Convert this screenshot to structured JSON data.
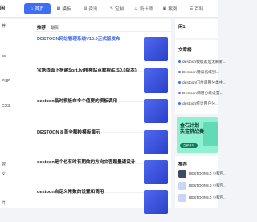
{
  "header": {
    "logo": "闲",
    "nav": [
      {
        "label": "首页",
        "icon": "home-icon",
        "glyph": "⌂",
        "active": true
      },
      {
        "label": "模板",
        "icon": "template-icon",
        "glyph": "▦",
        "active": false
      },
      {
        "label": "资讯",
        "icon": "news-icon",
        "glyph": "▤",
        "active": false
      },
      {
        "label": "定制",
        "icon": "custom-icon",
        "glyph": "✎",
        "active": false
      },
      {
        "label": "设计师",
        "icon": "designer-icon",
        "glyph": "☺",
        "active": false
      },
      {
        "label": "案例",
        "icon": "case-icon",
        "glyph": "▣",
        "active": false
      },
      {
        "label": "百科",
        "icon": "wiki-icon",
        "glyph": "☰",
        "active": false
      }
    ]
  },
  "left": {
    "items": [
      "荐",
      "",
      "ss",
      "",
      "",
      "PHP",
      "",
      "",
      "CSS",
      "",
      "",
      "",
      "",
      "",
      "",
      "容",
      "义",
      "",
      "",
      "",
      "件"
    ]
  },
  "main": {
    "tabs": [
      "推荐",
      "最新"
    ],
    "items": [
      {
        "title": "DESTOON网站管理系统V10.0正式版发布",
        "blue": true,
        "desc": "",
        "meta": "",
        "thumb": ""
      },
      {
        "title": "宝塔线面下搭建Sort.fyi排神站点教程(EIS0.0版本)",
        "blue": false,
        "desc": "",
        "meta": "",
        "thumb": ""
      },
      {
        "title": "destoon临时模板命令个值要的模板调用",
        "blue": false,
        "desc": "",
        "meta": "",
        "thumb": ""
      },
      {
        "title": "DESTOON 8 首全额检模板演示",
        "blue": false,
        "desc": "",
        "meta": "",
        "thumb": ""
      },
      {
        "title": "destoon是个也有时有期效的方向文客题量通设计",
        "blue": false,
        "desc": "",
        "meta": "",
        "thumb": ""
      },
      {
        "title": "destoon自定义常数的设置和调用",
        "blue": false,
        "desc": "",
        "meta": "",
        "thumb": ""
      }
    ]
  },
  "right": {
    "box1_title": "闲1",
    "box2_title": "文章榜",
    "articles": [
      "destoon模板家后无刷新...",
      "Destoon错误信级别...",
      "destoon门台调用分类中...",
      "Destoon调用分级设置...",
      "destoon统计用户分..."
    ],
    "banner": {
      "title_line1": "金石计划",
      "title_line2": "奖金挑战赛",
      "button": "立即参与"
    },
    "box3_title": "推荐",
    "recommends": [
      "DESTOON8.0 小程序...",
      "DESTOON8.0 小程序...",
      "DESTOON8.0 小程序..."
    ]
  },
  "colors": {
    "accent": "#3d6ef5",
    "thumb": "#3a53e0",
    "banner": "#8ff0d2"
  }
}
